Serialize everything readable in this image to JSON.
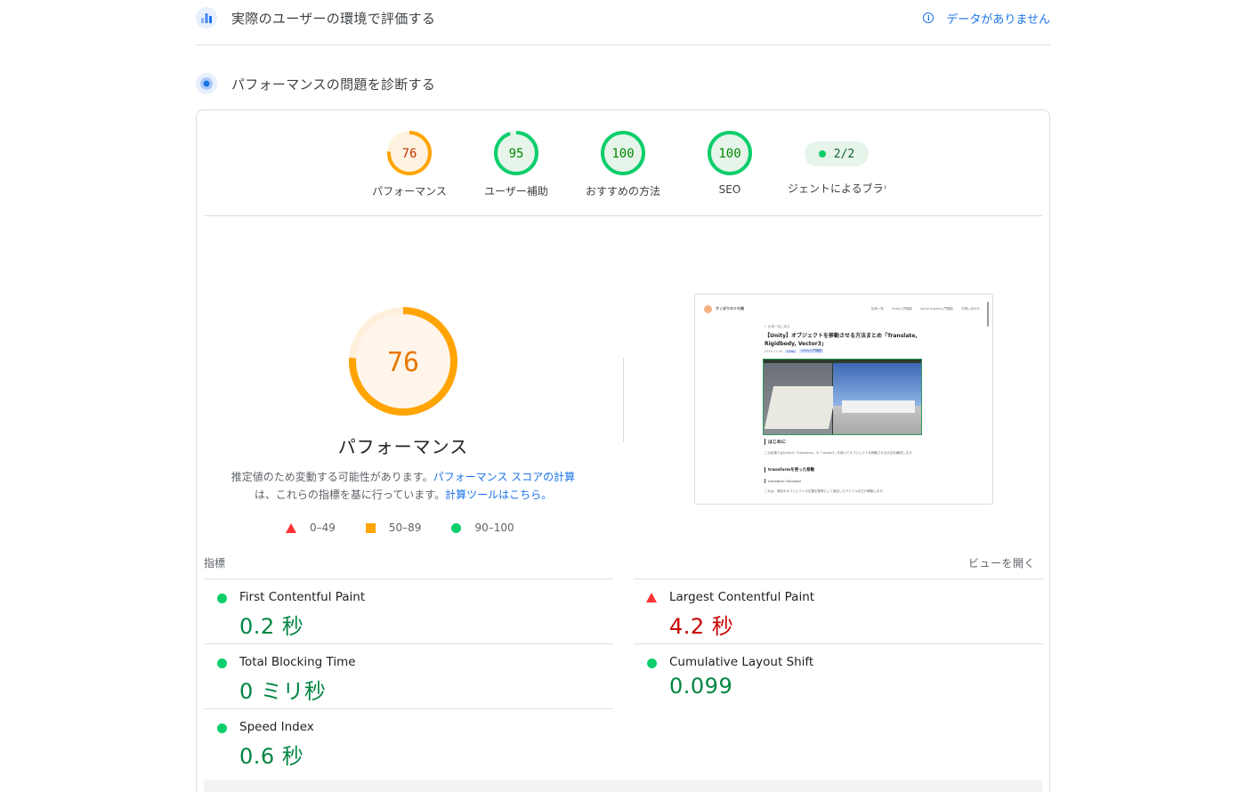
{
  "sections": {
    "field": {
      "title": "実際のユーザーの環境で評価する",
      "nodata": "データがありません"
    },
    "lab": {
      "title": "パフォーマンスの問題を診断する"
    }
  },
  "scores": [
    {
      "value": "76",
      "label": "パフォーマンス",
      "status": "average",
      "fraction": 0.76
    },
    {
      "value": "95",
      "label": "ユーザー補助",
      "status": "pass",
      "fraction": 0.95
    },
    {
      "value": "100",
      "label": "おすすめの方法",
      "status": "pass",
      "fraction": 1.0
    },
    {
      "value": "100",
      "label": "SEO",
      "status": "pass",
      "fraction": 1.0
    }
  ],
  "pwa": {
    "value": "2/2",
    "label": "ジェントによるブラウジ"
  },
  "main_score": {
    "value": "76",
    "fraction": 0.76,
    "title": "パフォーマンス",
    "desc_1": "推定値のため変動する可能性があります。",
    "desc_link_1": "パフォーマンス スコアの計算",
    "desc_2": "は、これらの指標を基に行っています。",
    "desc_link_2": "計算ツールはこちら。"
  },
  "legend": {
    "fail": "0–49",
    "average": "50–89",
    "pass": "90–100"
  },
  "screenshot": {
    "brand": "すくぼりのメモ帳",
    "nav": [
      "記事一覧",
      "Unity入門講座",
      "Spine Engine入門講座",
      "お問い合わせ"
    ],
    "crumb": "← 記事一覧に戻る",
    "title": "【Unity】オブジェクトを移動させる方法まとめ「Translate, Rigidbody, Vector3」",
    "date": "2019.11.05",
    "tags": [
      "Unity",
      "Unity入門講座"
    ],
    "h2": "はじめに",
    "p": "この記事ではUnityの「transform」や「vector3」を使ってオブジェクトを移動させる方法を解説します。",
    "h3": "transformを使った移動",
    "h4": "transform.Translate",
    "p2": "これは、現在のオブジェクトの位置を基準にして指定したベクトル分だけ移動します。"
  },
  "metrics_header": {
    "left": "指標",
    "right": "ビューを開く"
  },
  "metrics_left": [
    {
      "name": "First Contentful Paint",
      "value": "0.2 秒",
      "status": "good"
    },
    {
      "name": "Total Blocking Time",
      "value": "0 ミリ秒",
      "status": "good"
    },
    {
      "name": "Speed Index",
      "value": "0.6 秒",
      "status": "good"
    }
  ],
  "metrics_right": [
    {
      "name": "Largest Contentful Paint",
      "value": "4.2 秒",
      "status": "bad"
    },
    {
      "name": "Cumulative Layout Shift",
      "value": "0.099",
      "status": "good"
    }
  ],
  "colors": {
    "pass": "#0cce6b",
    "pass_text": "#008800",
    "pass_bg": "#e6f4ea",
    "average": "#ffa400",
    "average_text": "#c33300",
    "average_bg": "#fff3e0",
    "fail": "#ff3333",
    "fail_text": "#cc0000",
    "link": "#1a73e8"
  }
}
